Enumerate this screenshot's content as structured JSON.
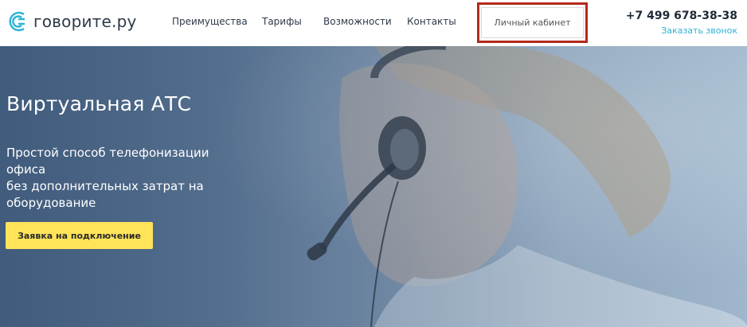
{
  "header": {
    "logo_text": "говорите.ру",
    "nav": [
      "Преимущества",
      "Тарифы",
      "Возможности",
      "Контакты"
    ],
    "cabinet_label": "Личный кабинет",
    "phone": "+7 499 678-38-38",
    "callback_label": "Заказать звонок"
  },
  "hero": {
    "title": "Виртуальная АТС",
    "subtitle_lines": [
      "Простой способ телефонизации офиса",
      "без дополнительных затрат на",
      "оборудование"
    ],
    "cta_label": "Заявка на подключение"
  },
  "colors": {
    "brand_text": "#2d3947",
    "accent_link": "#2ab3d6",
    "cta_bg": "#ffe45a",
    "highlight_border": "#b32a1c"
  }
}
